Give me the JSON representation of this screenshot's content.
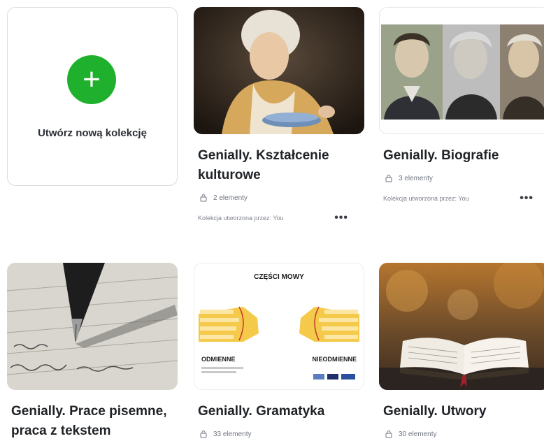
{
  "create": {
    "label": "Utwórz nową kolekcję",
    "icon": "plus-icon"
  },
  "cards": [
    {
      "title_line1": "Genially. Kształcenie",
      "title_line2": "kulturowe",
      "count": "2 elementy",
      "owner": "Kolekcja utworzona przez: You",
      "menu": "•••"
    },
    {
      "title_line1": "Genially. Biografie",
      "count": "3 elementy",
      "owner": "Kolekcja utworzona przez: You",
      "menu": "•••"
    },
    {
      "title_line1": "Genially. Prace pisemne,",
      "title_line2": "praca z tekstem"
    },
    {
      "title_line1": "Genially. Gramatyka",
      "count": "33 elementy"
    },
    {
      "title_line1": "Genially. Utwory",
      "count": "30 elementy"
    }
  ],
  "gramatyka_thumb": {
    "heading": "CZĘŚCI MOWY",
    "left_label": "ODMIENNE",
    "right_label": "NIEODMIENNE"
  },
  "colors": {
    "accent_green": "#1fb12e",
    "hand_yellow": "#f5c94a"
  }
}
